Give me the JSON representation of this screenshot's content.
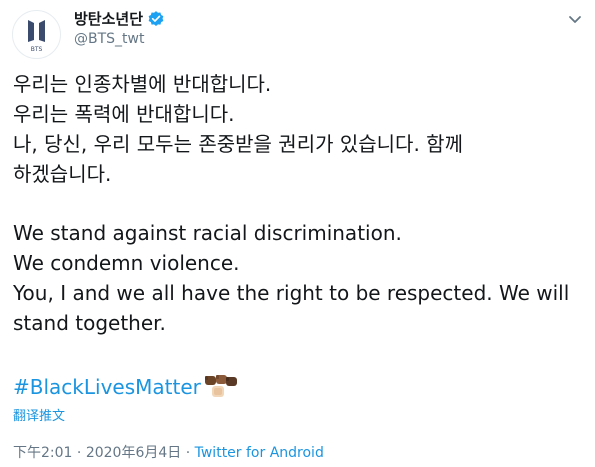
{
  "author": {
    "display_name": "방탄소년단",
    "handle": "@BTS_twt",
    "avatar_text": "BTS"
  },
  "tweet": {
    "korean_lines": [
      "우리는 인종차별에 반대합니다.",
      "우리는 폭력에 반대합니다.",
      "나, 당신, 우리 모두는 존중받을 권리가 있습니다. 함께",
      "하겠습니다."
    ],
    "english_lines": [
      "We stand against racial discrimination.",
      "We condemn violence.",
      "You, I and we all have the right to be respected. We will",
      "stand together."
    ],
    "hashtag": "#BlackLivesMatter",
    "emoji": [
      "fist-icon",
      "fist-icon",
      "fist-icon"
    ],
    "translate_label": "翻译推文"
  },
  "meta": {
    "time": "下午2:01",
    "separator": "·",
    "date": "2020年6月4日",
    "source": "Twitter for Android"
  },
  "colors": {
    "link": "#1b95e0",
    "secondary": "#657786",
    "text": "#14171a",
    "verified": "#1da1f2"
  }
}
